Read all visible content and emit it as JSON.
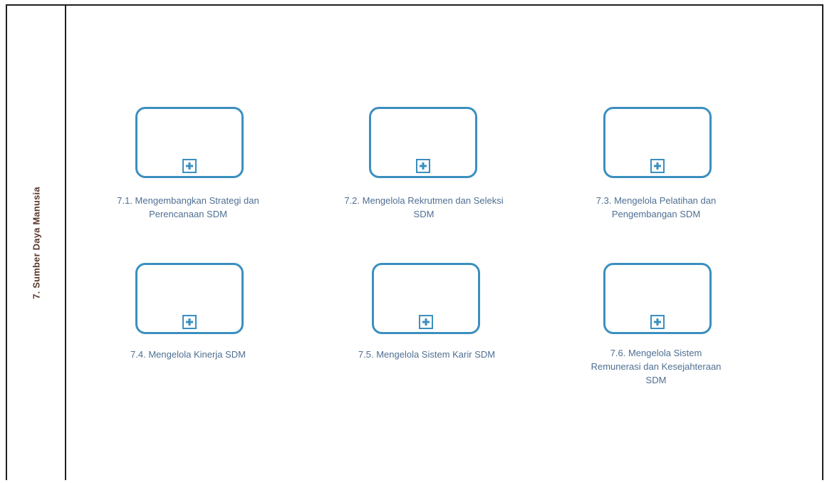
{
  "lane": {
    "label": "7. Sumber Daya Manusia"
  },
  "colors": {
    "task_stroke": "#3b8fbf",
    "caption_text": "#4f6f93",
    "lane_text": "#5a3a2e"
  },
  "tasks": [
    {
      "label": "7.1. Mengembangkan Strategi dan Perencanaan SDM",
      "marker_icon": "subprocess-plus-icon"
    },
    {
      "label": "7.2. Mengelola Rekrutmen dan Seleksi SDM",
      "marker_icon": "subprocess-plus-icon"
    },
    {
      "label": "7.3. Mengelola Pelatihan dan Pengembangan SDM",
      "marker_icon": "subprocess-plus-icon"
    },
    {
      "label": "7.4. Mengelola Kinerja SDM",
      "marker_icon": "subprocess-plus-icon"
    },
    {
      "label": "7.5. Mengelola Sistem Karir SDM",
      "marker_icon": "subprocess-plus-icon"
    },
    {
      "label": "7.6. Mengelola Sistem Remunerasi dan Kesejahteraan SDM",
      "marker_icon": "subprocess-plus-icon"
    }
  ]
}
